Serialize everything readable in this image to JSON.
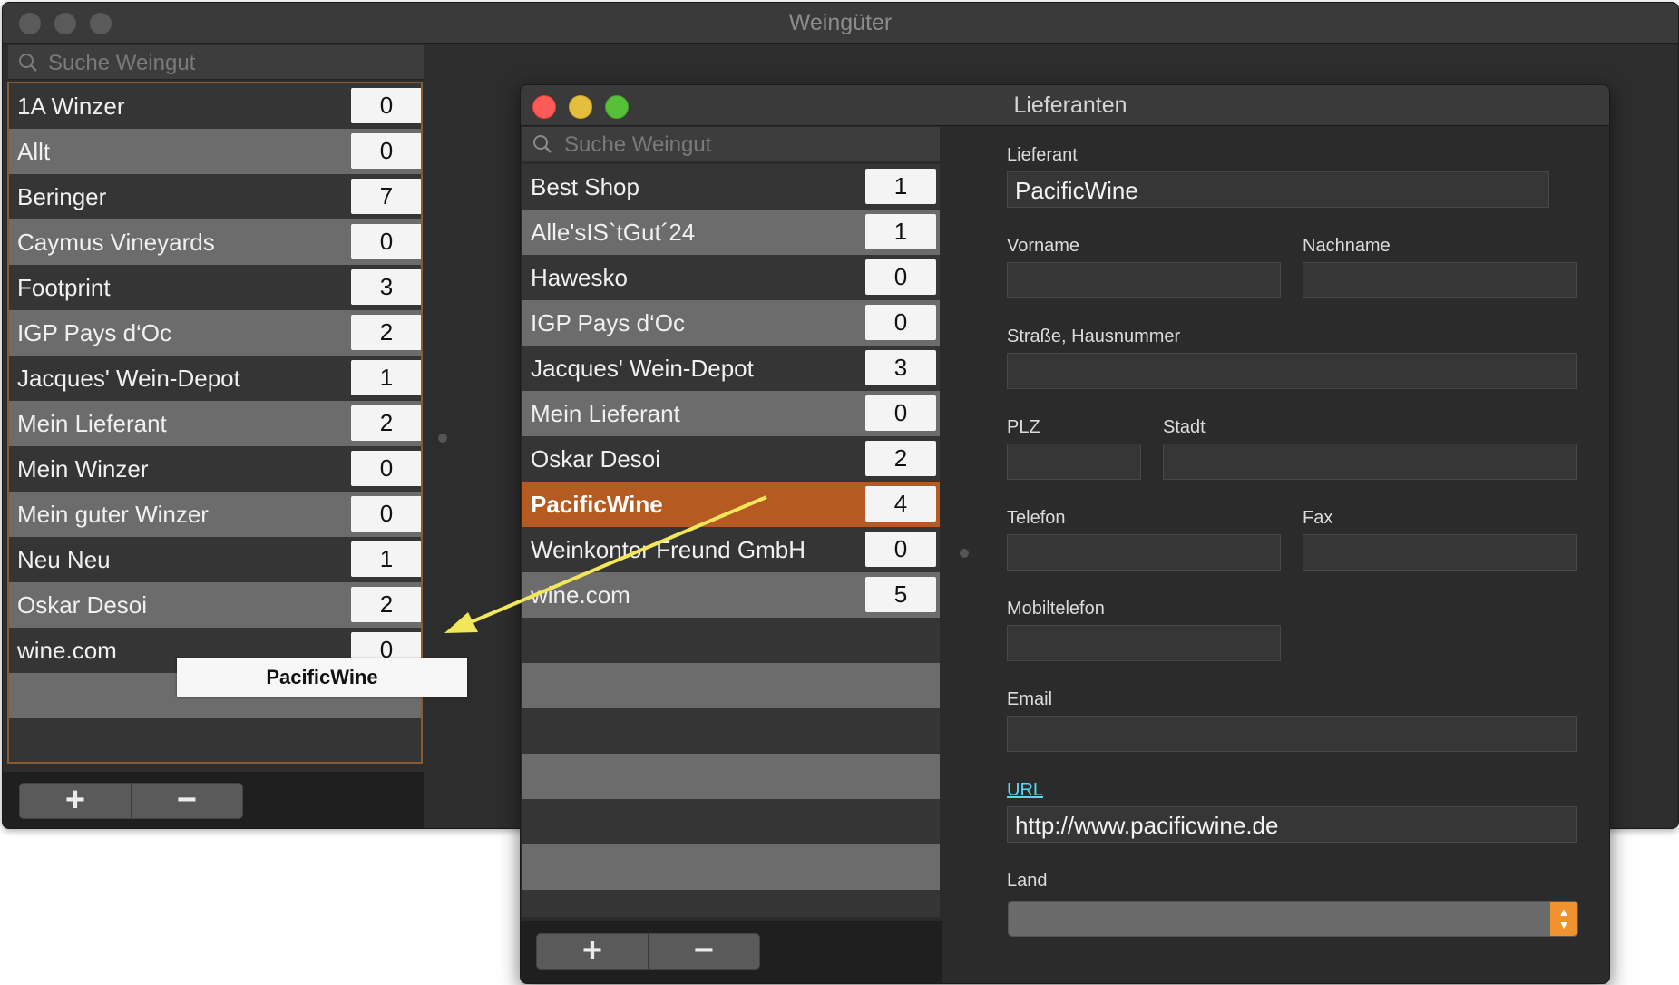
{
  "main_window": {
    "title": "Weingüter",
    "search_placeholder": "Suche Weingut",
    "rows": [
      {
        "name": "1A Winzer",
        "count": "0"
      },
      {
        "name": "Allt",
        "count": "0"
      },
      {
        "name": "Beringer",
        "count": "7"
      },
      {
        "name": "Caymus Vineyards",
        "count": "0"
      },
      {
        "name": "Footprint",
        "count": "3"
      },
      {
        "name": "IGP Pays d‘Oc",
        "count": "2"
      },
      {
        "name": "Jacques' Wein-Depot",
        "count": "1"
      },
      {
        "name": "Mein Lieferant",
        "count": "2"
      },
      {
        "name": "Mein Winzer",
        "count": "0"
      },
      {
        "name": "Mein guter Winzer",
        "count": "0"
      },
      {
        "name": "Neu Neu",
        "count": "1"
      },
      {
        "name": "Oskar Desoi",
        "count": "2"
      },
      {
        "name": "wine.com",
        "count": "0"
      }
    ],
    "add_label": "+",
    "remove_label": "−"
  },
  "drag_chip": "PacificWine",
  "suppliers_window": {
    "title": "Lieferanten",
    "search_placeholder": "Suche Weingut",
    "rows": [
      {
        "name": "Best Shop",
        "count": "1"
      },
      {
        "name": "Alle'sIS`tGut´24",
        "count": "1"
      },
      {
        "name": "Hawesko",
        "count": "0"
      },
      {
        "name": "IGP Pays d‘Oc",
        "count": "0"
      },
      {
        "name": "Jacques' Wein-Depot",
        "count": "3"
      },
      {
        "name": "Mein Lieferant",
        "count": "0"
      },
      {
        "name": "Oskar Desoi",
        "count": "2"
      },
      {
        "name": "PacificWine",
        "count": "4"
      },
      {
        "name": "Weinkontor Freund GmbH",
        "count": "0"
      },
      {
        "name": "wine.com",
        "count": "5"
      }
    ],
    "selected_index": 7,
    "add_label": "+",
    "remove_label": "−",
    "form": {
      "lieferant_label": "Lieferant",
      "lieferant_value": "PacificWine",
      "vorname_label": "Vorname",
      "vorname_value": "",
      "nachname_label": "Nachname",
      "nachname_value": "",
      "strasse_label": "Straße, Hausnummer",
      "strasse_value": "",
      "plz_label": "PLZ",
      "plz_value": "",
      "stadt_label": "Stadt",
      "stadt_value": "",
      "telefon_label": "Telefon",
      "telefon_value": "",
      "fax_label": "Fax",
      "fax_value": "",
      "mobil_label": "Mobiltelefon",
      "mobil_value": "",
      "email_label": "Email",
      "email_value": "",
      "url_label": "URL",
      "url_value": "http://www.pacificwine.de",
      "land_label": "Land",
      "land_value": ""
    }
  },
  "colors": {
    "selection": "#b55a20",
    "arrow": "#f2e65a",
    "url_link": "#5fd5f2",
    "stepper_accent": "#f0922e"
  }
}
